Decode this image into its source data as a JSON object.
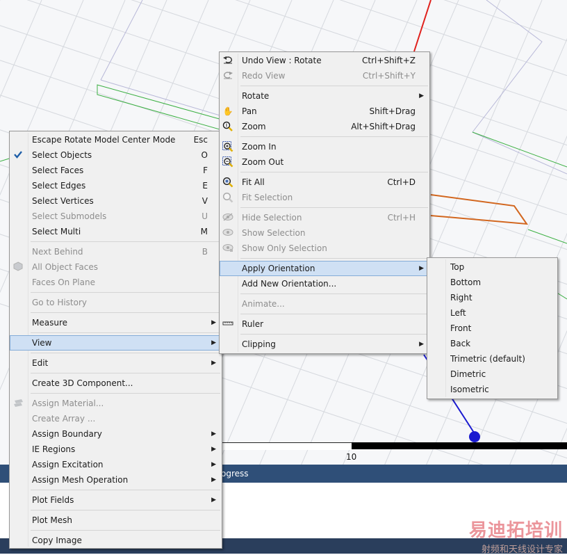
{
  "context_menu": {
    "items": [
      {
        "label": "Escape Rotate Model Center Mode",
        "shortcut": "Esc"
      },
      {
        "label": "Select Objects",
        "shortcut": "O",
        "icon": "checkmark-icon"
      },
      {
        "label": "Select Faces",
        "shortcut": "F"
      },
      {
        "label": "Select Edges",
        "shortcut": "E"
      },
      {
        "label": "Select Vertices",
        "shortcut": "V"
      },
      {
        "label": "Select Submodels",
        "shortcut": "U"
      },
      {
        "label": "Select Multi",
        "shortcut": "M"
      },
      {
        "label": "Next Behind",
        "shortcut": "B"
      },
      {
        "label": "All Object Faces",
        "icon": "object-faces-icon"
      },
      {
        "label": "Faces On Plane"
      },
      {
        "label": "Go to History"
      },
      {
        "label": "Measure"
      },
      {
        "label": "View"
      },
      {
        "label": "Edit"
      },
      {
        "label": "Create 3D Component..."
      },
      {
        "label": "Assign Material...",
        "icon": "material-icon"
      },
      {
        "label": "Create Array ..."
      },
      {
        "label": "Assign Boundary"
      },
      {
        "label": "IE Regions"
      },
      {
        "label": "Assign Excitation"
      },
      {
        "label": "Assign Mesh Operation"
      },
      {
        "label": "Plot Fields"
      },
      {
        "label": "Plot Mesh"
      },
      {
        "label": "Copy Image"
      }
    ]
  },
  "view_menu": {
    "items": [
      {
        "label": "Undo View : Rotate",
        "shortcut": "Ctrl+Shift+Z",
        "icon": "undo-view-icon"
      },
      {
        "label": "Redo View",
        "shortcut": "Ctrl+Shift+Y",
        "icon": "redo-view-icon"
      },
      {
        "label": "Rotate"
      },
      {
        "label": "Pan",
        "shortcut": "Shift+Drag",
        "icon": "pan-hand-icon"
      },
      {
        "label": "Zoom",
        "shortcut": "Alt+Shift+Drag",
        "icon": "zoom-icon"
      },
      {
        "label": "Zoom In",
        "icon": "zoom-in-icon"
      },
      {
        "label": "Zoom Out",
        "icon": "zoom-out-icon"
      },
      {
        "label": "Fit All",
        "shortcut": "Ctrl+D",
        "icon": "fit-all-icon"
      },
      {
        "label": "Fit Selection",
        "icon": "fit-selection-icon"
      },
      {
        "label": "Hide Selection",
        "shortcut": "Ctrl+H",
        "icon": "hide-selection-icon"
      },
      {
        "label": "Show Selection",
        "icon": "show-selection-icon"
      },
      {
        "label": "Show Only Selection",
        "icon": "show-only-selection-icon"
      },
      {
        "label": "Apply Orientation"
      },
      {
        "label": "Add New Orientation..."
      },
      {
        "label": "Animate..."
      },
      {
        "label": "Ruler",
        "icon": "ruler-icon"
      },
      {
        "label": "Clipping"
      }
    ]
  },
  "orientation_menu": {
    "items": [
      {
        "label": "Top"
      },
      {
        "label": "Bottom"
      },
      {
        "label": "Right"
      },
      {
        "label": "Left"
      },
      {
        "label": "Front"
      },
      {
        "label": "Back"
      },
      {
        "label": "Trimetric (default)"
      },
      {
        "label": "Dimetric"
      },
      {
        "label": "Isometric"
      }
    ]
  },
  "ruler": {
    "label": "10"
  },
  "status_strip": {
    "text": "ogress"
  },
  "watermark": {
    "line1": "易迪拓培训",
    "line2": "射频和天线设计专家"
  },
  "colors": {
    "highlight": "#cfe0f4",
    "menu_bg": "#f0f0f0",
    "status_bar": "#2f4f78",
    "accent_check": "#1f5fa8"
  }
}
